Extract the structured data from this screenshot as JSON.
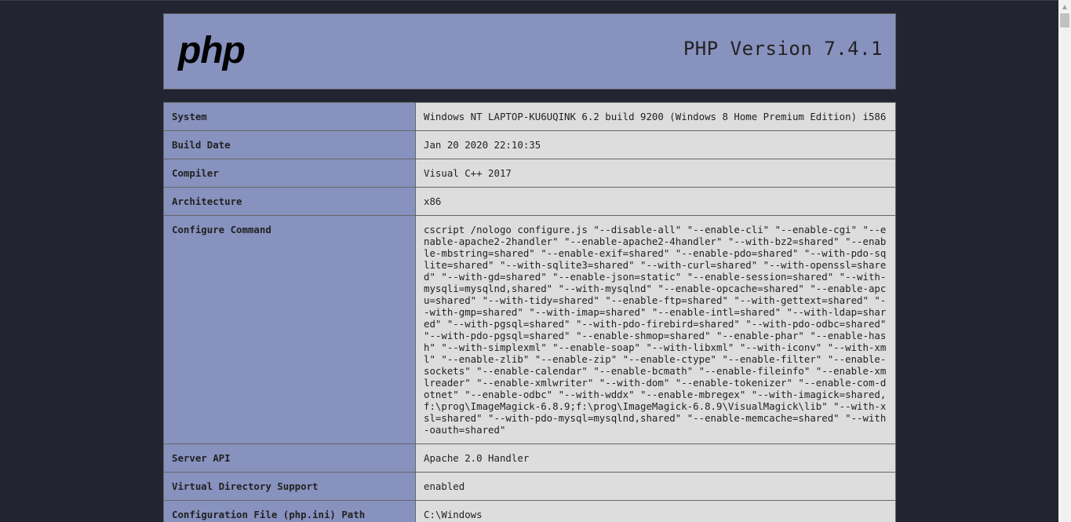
{
  "header": {
    "logo_text": "php",
    "version_title": "PHP Version 7.4.1"
  },
  "rows": [
    {
      "key": "System",
      "value": "Windows NT LAPTOP-KU6UQINK 6.2 build 9200 (Windows 8 Home Premium Edition) i586"
    },
    {
      "key": "Build Date",
      "value": "Jan 20 2020 22:10:35"
    },
    {
      "key": "Compiler",
      "value": "Visual C++ 2017"
    },
    {
      "key": "Architecture",
      "value": "x86"
    },
    {
      "key": "Configure Command",
      "value": "cscript /nologo configure.js \"--disable-all\" \"--enable-cli\" \"--enable-cgi\" \"--enable-apache2-2handler\" \"--enable-apache2-4handler\" \"--with-bz2=shared\" \"--enable-mbstring=shared\" \"--enable-exif=shared\" \"--enable-pdo=shared\" \"--with-pdo-sqlite=shared\" \"--with-sqlite3=shared\" \"--with-curl=shared\" \"--with-openssl=shared\" \"--with-gd=shared\" \"--enable-json=static\" \"--enable-session=shared\" \"--with-mysqli=mysqlnd,shared\" \"--with-mysqlnd\" \"--enable-opcache=shared\" \"--enable-apcu=shared\" \"--with-tidy=shared\" \"--enable-ftp=shared\" \"--with-gettext=shared\" \"--with-gmp=shared\" \"--with-imap=shared\" \"--enable-intl=shared\" \"--with-ldap=shared\" \"--with-pgsql=shared\" \"--with-pdo-firebird=shared\" \"--with-pdo-odbc=shared\" \"--with-pdo-pgsql=shared\" \"--enable-shmop=shared\" \"--enable-phar\" \"--enable-hash\" \"--with-simplexml\" \"--enable-soap\" \"--with-libxml\" \"--with-iconv\" \"--with-xml\" \"--enable-zlib\" \"--enable-zip\" \"--enable-ctype\" \"--enable-filter\" \"--enable-sockets\" \"--enable-calendar\" \"--enable-bcmath\" \"--enable-fileinfo\" \"--enable-xmlreader\" \"--enable-xmlwriter\" \"--with-dom\" \"--enable-tokenizer\" \"--enable-com-dotnet\" \"--enable-odbc\" \"--with-wddx\" \"--enable-mbregex\" \"--with-imagick=shared,f:\\prog\\ImageMagick-6.8.9;f:\\prog\\ImageMagick-6.8.9\\VisualMagick\\lib\" \"--with-xsl=shared\" \"--with-pdo-mysql=mysqlnd,shared\" \"--enable-memcache=shared\" \"--with-oauth=shared\""
    },
    {
      "key": "Server API",
      "value": "Apache 2.0 Handler"
    },
    {
      "key": "Virtual Directory Support",
      "value": "enabled"
    },
    {
      "key": "Configuration File (php.ini) Path",
      "value": "C:\\Windows"
    }
  ],
  "colors": {
    "page_bg": "#222431",
    "header_bg": "#8892bf",
    "key_bg": "#8892bf",
    "value_bg": "#dddddd"
  },
  "icons": {
    "logo": "php-logo",
    "scroll_up": "triangle-up-icon"
  }
}
